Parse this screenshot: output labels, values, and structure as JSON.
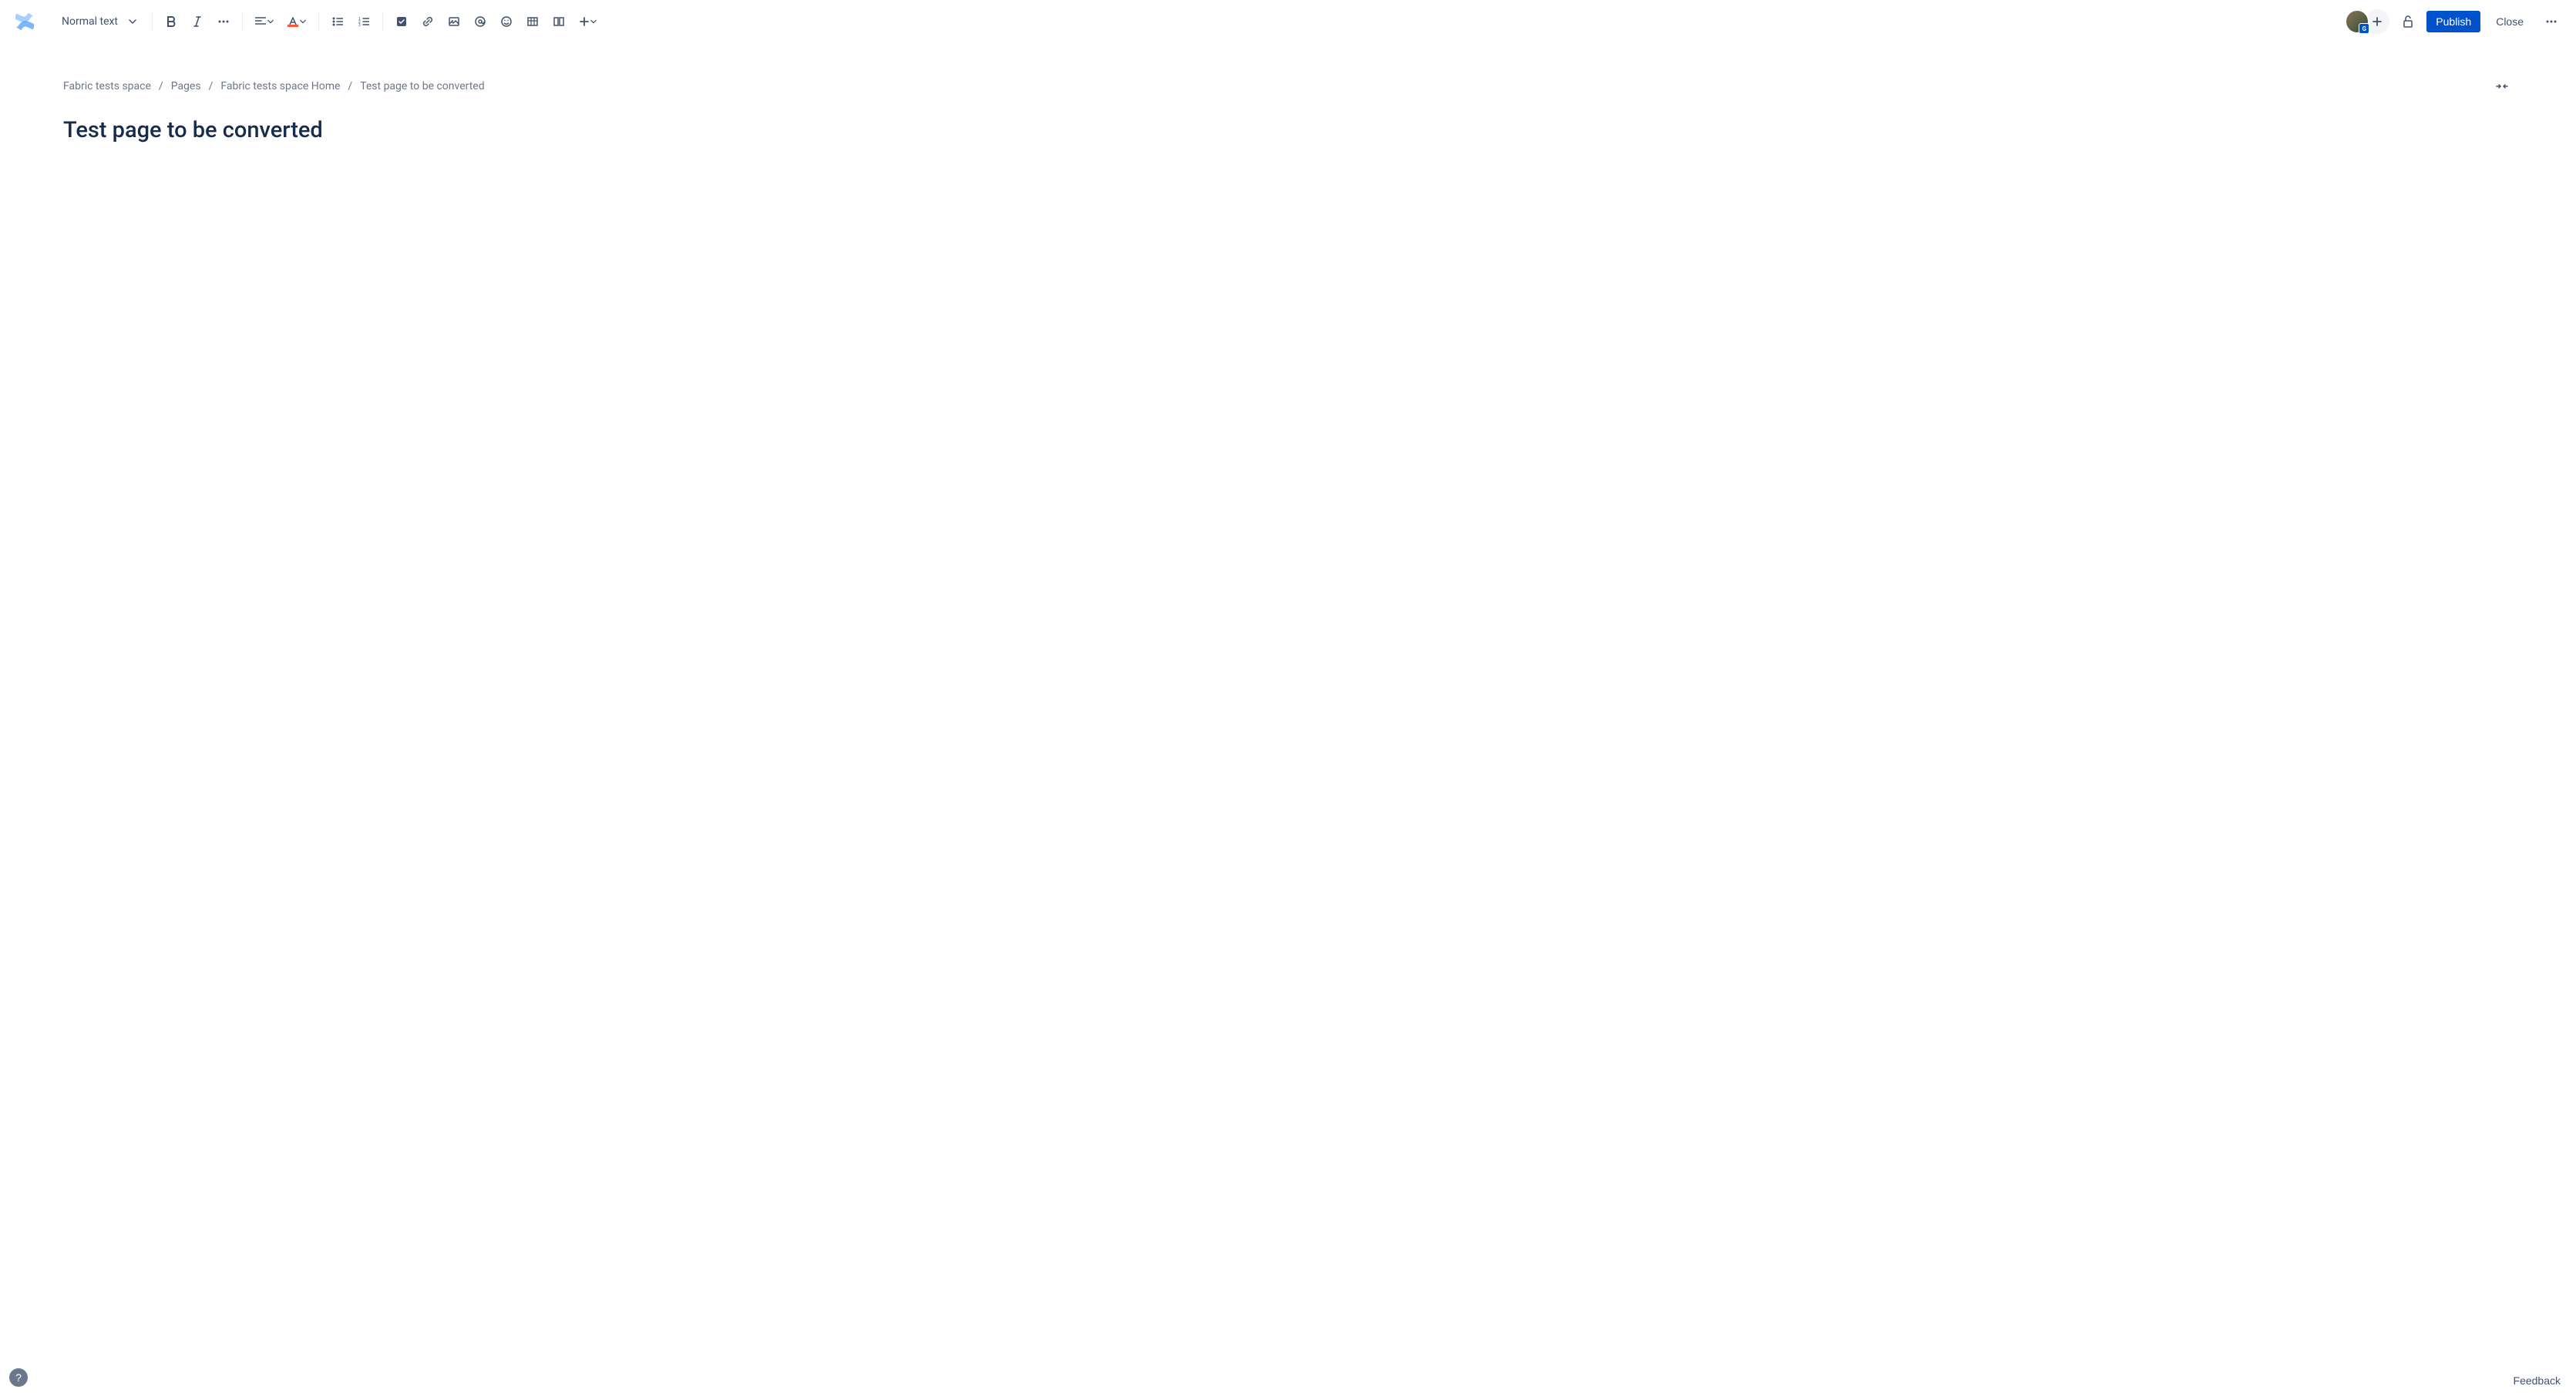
{
  "toolbar": {
    "text_style": "Normal text",
    "publish_label": "Publish",
    "close_label": "Close"
  },
  "avatar": {
    "badge": "G"
  },
  "breadcrumb": {
    "items": [
      "Fabric tests space",
      "Pages",
      "Fabric tests space Home",
      "Test page to be converted"
    ]
  },
  "page": {
    "title": "Test page to be converted"
  },
  "footer": {
    "help": "?",
    "feedback": "Feedback"
  }
}
